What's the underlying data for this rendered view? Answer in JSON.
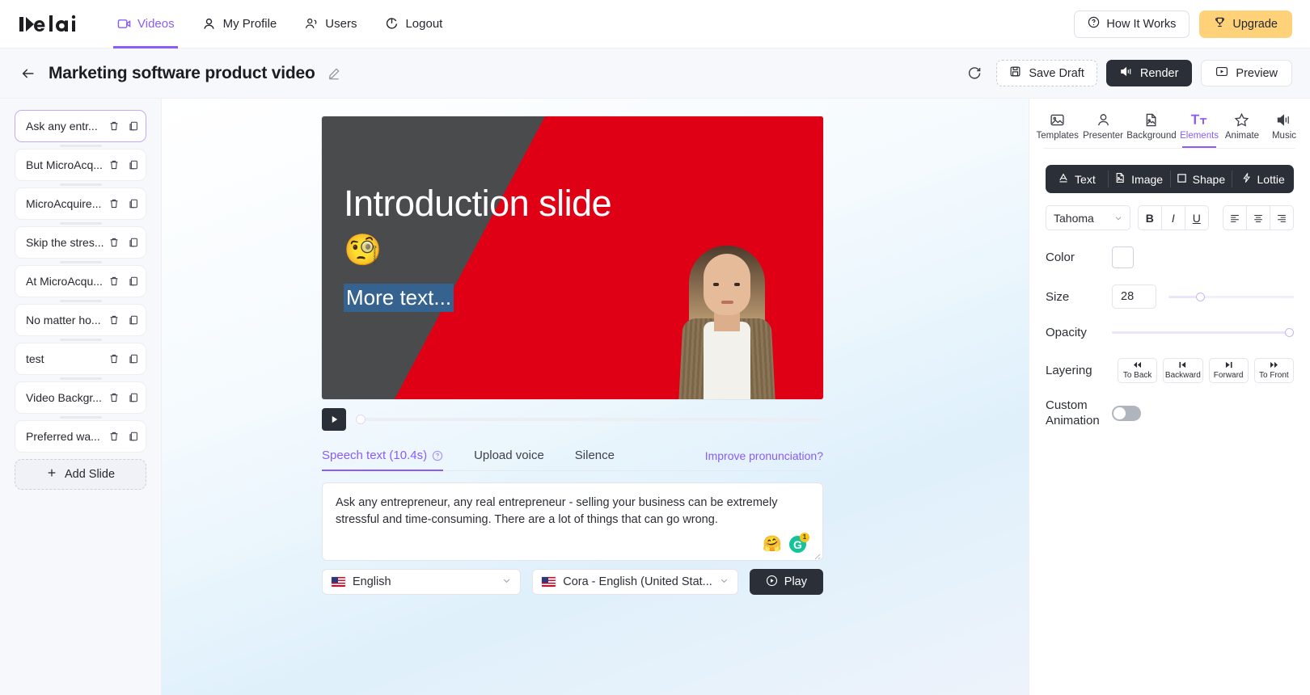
{
  "topnav": {
    "logo_text": "elai",
    "items": [
      {
        "label": "Videos",
        "icon": "video-icon",
        "active": true
      },
      {
        "label": "My Profile",
        "icon": "user-icon",
        "active": false
      },
      {
        "label": "Users",
        "icon": "users-icon",
        "active": false
      },
      {
        "label": "Logout",
        "icon": "logout-icon",
        "active": false
      }
    ],
    "how_it_works": "How It Works",
    "upgrade": "Upgrade"
  },
  "subheader": {
    "title": "Marketing software product video",
    "save_draft": "Save Draft",
    "render": "Render",
    "preview": "Preview"
  },
  "sidebar": {
    "slides": [
      {
        "label": "Ask any entr...",
        "active": true
      },
      {
        "label": "But MicroAcq...",
        "active": false
      },
      {
        "label": "MicroAcquire...",
        "active": false
      },
      {
        "label": "Skip the stres...",
        "active": false
      },
      {
        "label": "At MicroAcqu...",
        "active": false
      },
      {
        "label": "No matter ho...",
        "active": false
      },
      {
        "label": "test",
        "active": false
      },
      {
        "label": "Video Backgr...",
        "active": false
      },
      {
        "label": "Preferred wa...",
        "active": false
      }
    ],
    "add_slide": "Add Slide"
  },
  "canvas": {
    "title": "Introduction slide",
    "emoji": "🧐",
    "more_text": "More text...",
    "bg_dark": "#4a4b4d",
    "bg_red": "#e00016",
    "selection_color": "#36628f"
  },
  "editor": {
    "tabs": [
      {
        "label": "Speech text (10.4s)",
        "active": true,
        "has_help": true
      },
      {
        "label": "Upload voice",
        "active": false,
        "has_help": false
      },
      {
        "label": "Silence",
        "active": false,
        "has_help": false
      }
    ],
    "improve_link": "Improve pronunciation?",
    "speech_text": "Ask any entrepreneur, any real entrepreneur - selling your business can be extremely stressful and time-consuming. There are a lot of things that can go wrong.",
    "emoji_button": "🤗",
    "grammarly_letter": "G",
    "grammarly_badge": "1",
    "language": "English",
    "voice": "Cora - English (United Stat...",
    "play": "Play"
  },
  "rightpanel": {
    "tabs": [
      {
        "label": "Templates",
        "icon": "image-icon",
        "active": false
      },
      {
        "label": "Presenter",
        "icon": "person-icon",
        "active": false
      },
      {
        "label": "Background",
        "icon": "file-image-icon",
        "active": false
      },
      {
        "label": "Elements",
        "icon": "text-size-icon",
        "active": true
      },
      {
        "label": "Animate",
        "icon": "star-icon",
        "active": false
      },
      {
        "label": "Music",
        "icon": "speaker-icon",
        "active": false
      }
    ],
    "insert": [
      {
        "label": "Text",
        "icon": "letter-a-icon"
      },
      {
        "label": "Image",
        "icon": "image-file-icon"
      },
      {
        "label": "Shape",
        "icon": "square-icon"
      },
      {
        "label": "Lottie",
        "icon": "lightning-icon"
      }
    ],
    "font": "Tahoma",
    "format_buttons": [
      "B",
      "I",
      "U",
      "align-left",
      "align-center",
      "align-right"
    ],
    "color_label": "Color",
    "color_value": "#ffffff",
    "size_label": "Size",
    "size_value": "28",
    "size_percent": 25,
    "opacity_label": "Opacity",
    "opacity_percent": 100,
    "layering_label": "Layering",
    "layering": [
      {
        "label": "To Back",
        "icon": "◀◀"
      },
      {
        "label": "Backward",
        "icon": "◀▌"
      },
      {
        "label": "Forward",
        "icon": "▌▶"
      },
      {
        "label": "To Front",
        "icon": "▶▶"
      }
    ],
    "custom_animation_label": "Custom Animation",
    "custom_animation_on": false
  },
  "colors": {
    "accent": "#8b5cf6",
    "dark": "#2b2f38",
    "upgrade": "#ffd27a"
  }
}
